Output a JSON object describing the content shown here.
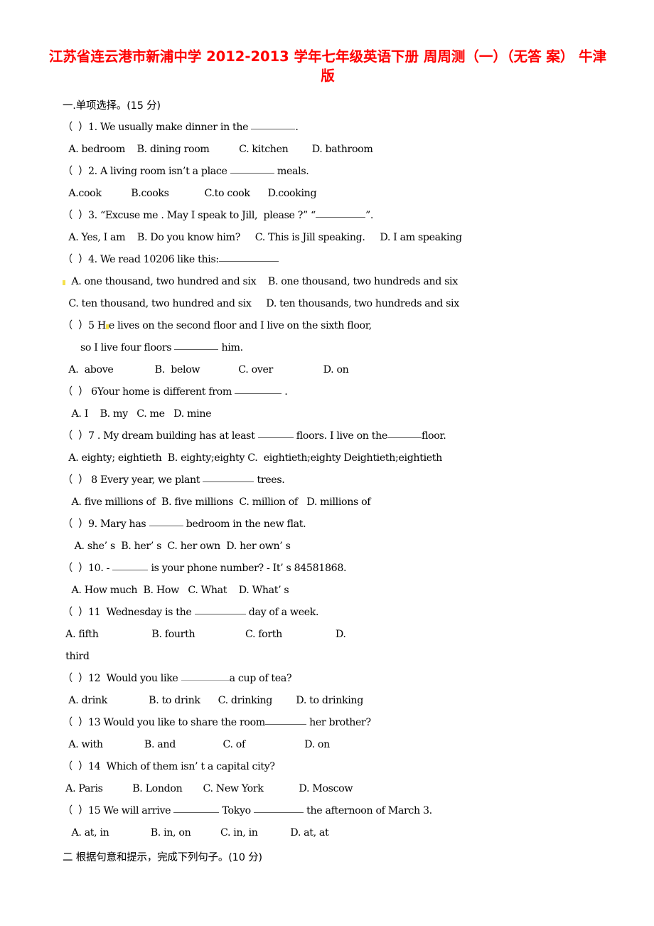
{
  "document": {
    "title_line1": "江苏省连云港市新浦中学 2012-2013 学年七年级英语下册  周周测（一）（无答",
    "title_line2": "案）  牛津版",
    "title_color": "#ff0000",
    "section1_heading": "一.单项选择。(15 分)",
    "section2_heading": "二 根据句意和提示，完成下列句子。(10 分)"
  },
  "questions": [
    {
      "id": "q1",
      "stem_pre": "（  ）1. We usually make dinner in the ",
      "blank_width": 62,
      "stem_post": ".",
      "options": "  A. bedroom    B. dining room          C. kitchen        D. bathroom"
    },
    {
      "id": "q2",
      "stem_pre": "（  ）2. A living room isn’t a place ",
      "blank_width": 62,
      "stem_post": " meals.",
      "options": "  A.cook          B.cooks            C.to cook      D.cooking"
    },
    {
      "id": "q3",
      "stem_pre": "（  ）3. “Excuse me . May I speak to Jill,  please ?” “",
      "blank_width": 70,
      "stem_post": "”.",
      "options": "  A. Yes, I am    B. Do you know him?     C. This is Jill speaking.     D. I am speaking"
    },
    {
      "id": "q4",
      "stem_pre": "（  ）4. We read 10206 like this:",
      "blank_width": 84,
      "stem_post": "",
      "options_a": "  A. one thousand, two hundred and six    B. one thousand, two hundreds and six",
      "options_b": "  C. ten thousand, two hundred and six     D. ten thousands, two hundreds and six"
    },
    {
      "id": "q5",
      "stem_pre": "（  ）5 H",
      "stem_mid": "e lives on the second floor and I live on the sixth floor,",
      "stem_line2_pre": "      so I live four floors ",
      "blank_width": 62,
      "stem_line2_post": " him.",
      "options": "  A.  above              B.  below             C. over                 D. on"
    },
    {
      "id": "q6",
      "stem_pre": "（  ） 6Your home is different from ",
      "blank_width": 66,
      "stem_post": " .",
      "options": "   A. I    B. my   C. me   D. mine"
    },
    {
      "id": "q7",
      "stem_pre": "（  ）7 . My dream building has at least ",
      "blank_width": 50,
      "stem_mid2": " floors. I live on the",
      "blank2_width": 48,
      "stem_post": "floor.",
      "options": "  A. eighty; eightieth  B. eighty;eighty C.  eightieth;eighty Deightieth;eightieth"
    },
    {
      "id": "q8",
      "stem_pre": "（  ） 8 Every year, we plant ",
      "blank_width": 72,
      "stem_post": " trees.",
      "options": "   A. five millions of  B. five millions  C. million of   D. millions of"
    },
    {
      "id": "q9",
      "stem_pre": "（  ）9. Mary has ",
      "blank_width": 48,
      "stem_post": " bedroom in the new flat.",
      "options": "    A. she’ s  B. her’ s  C. her own  D. her own’ s"
    },
    {
      "id": "q10",
      "stem_pre": "（  ）10. - ",
      "blank_width": 50,
      "stem_post": " is your phone number? - It’ s 84581868.",
      "options": "   A. How much  B. How   C. What    D. What’ s"
    },
    {
      "id": "q11",
      "stem_pre": "（  ）11  Wednesday is the ",
      "blank_width": 72,
      "stem_post": " day of a week.",
      "options": " A. fifth                  B. fourth                 C. forth                  D.",
      "options_wrap": " third"
    },
    {
      "id": "q12",
      "stem_pre": "（  ）12  Would you like ",
      "blank_width": 68,
      "stem_post": "a cup of tea?",
      "options": "  A. drink              B. to drink      C. drinking        D. to drinking"
    },
    {
      "id": "q13",
      "stem_pre": "（  ）13 Would you like to share the room",
      "blank_width": 58,
      "stem_post": " her brother?",
      "options": "  A. with              B. and                C. of                    D. on"
    },
    {
      "id": "q14",
      "stem_pre": "（  ）14  Which of them isn’ t a capital city?",
      "blank_width": 0,
      "stem_post": "",
      "options": " A. Paris          B. London       C. New York            D. Moscow"
    },
    {
      "id": "q15",
      "stem_pre": "（  ）15 We will arrive ",
      "blank_width": 64,
      "stem_mid2": " Tokyo ",
      "blank2_width": 70,
      "stem_post": " the afternoon of March 3.",
      "options": "   A. at, in              B. in, on          C. in, in           D. at, at"
    }
  ]
}
